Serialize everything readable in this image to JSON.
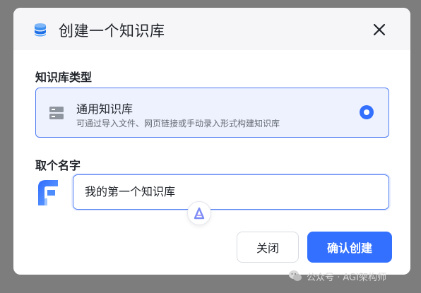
{
  "dialog": {
    "title": "创建一个知识库",
    "type_section_label": "知识库类型",
    "type_option": {
      "name": "通用知识库",
      "description": "可通过导入文件、网页链接或手动录入形式构建知识库",
      "selected": true
    },
    "name_section_label": "取个名字",
    "name_input_value": "我的第一个知识库",
    "cancel_label": "关闭",
    "confirm_label": "确认创建"
  },
  "watermark": {
    "text": "公众号 · AGI架构师"
  },
  "colors": {
    "accent": "#3370ff",
    "overlay": "#7d7d7d",
    "header_bg": "#f6f6f8",
    "card_bg": "#eef2fe"
  }
}
